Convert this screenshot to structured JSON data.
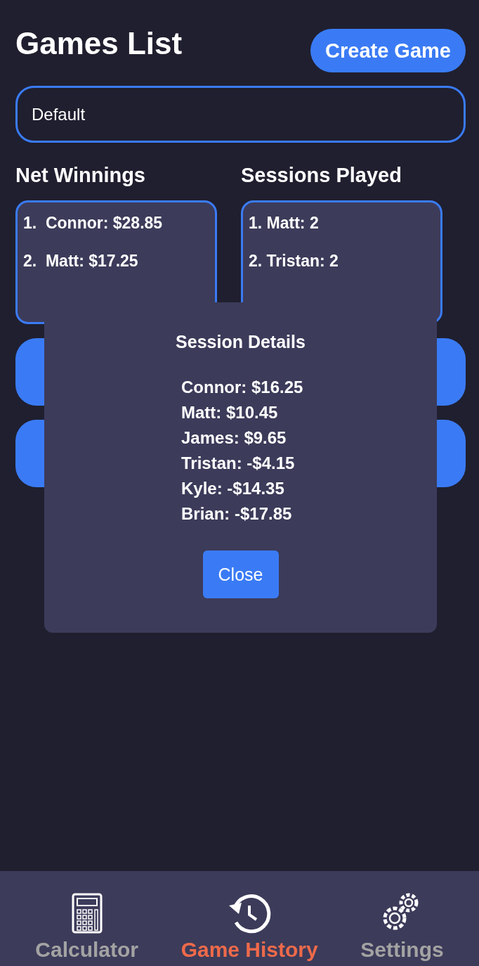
{
  "header": {
    "title": "Games List",
    "create_button": "Create Game"
  },
  "game_select": {
    "value": "Default"
  },
  "leaderboards": [
    {
      "title": "Net Winnings",
      "entries": [
        "1.  Connor: $28.85",
        "2.  Matt: $17.25"
      ]
    },
    {
      "title": "Sessions Played",
      "entries": [
        "1. Matt: 2",
        "2. Tristan: 2"
      ]
    }
  ],
  "modal": {
    "title": "Session Details",
    "lines": [
      "Connor: $16.25",
      "Matt: $10.45",
      "James: $9.65",
      "Tristan: -$4.15",
      "Kyle: -$14.35",
      "Brian: -$17.85"
    ],
    "close_button": "Close"
  },
  "tab_bar": [
    {
      "label": "Calculator",
      "kind": "calculator",
      "selected": false
    },
    {
      "label": "Game History",
      "kind": "history",
      "selected": true
    },
    {
      "label": "Settings",
      "kind": "gears",
      "selected": false
    }
  ]
}
